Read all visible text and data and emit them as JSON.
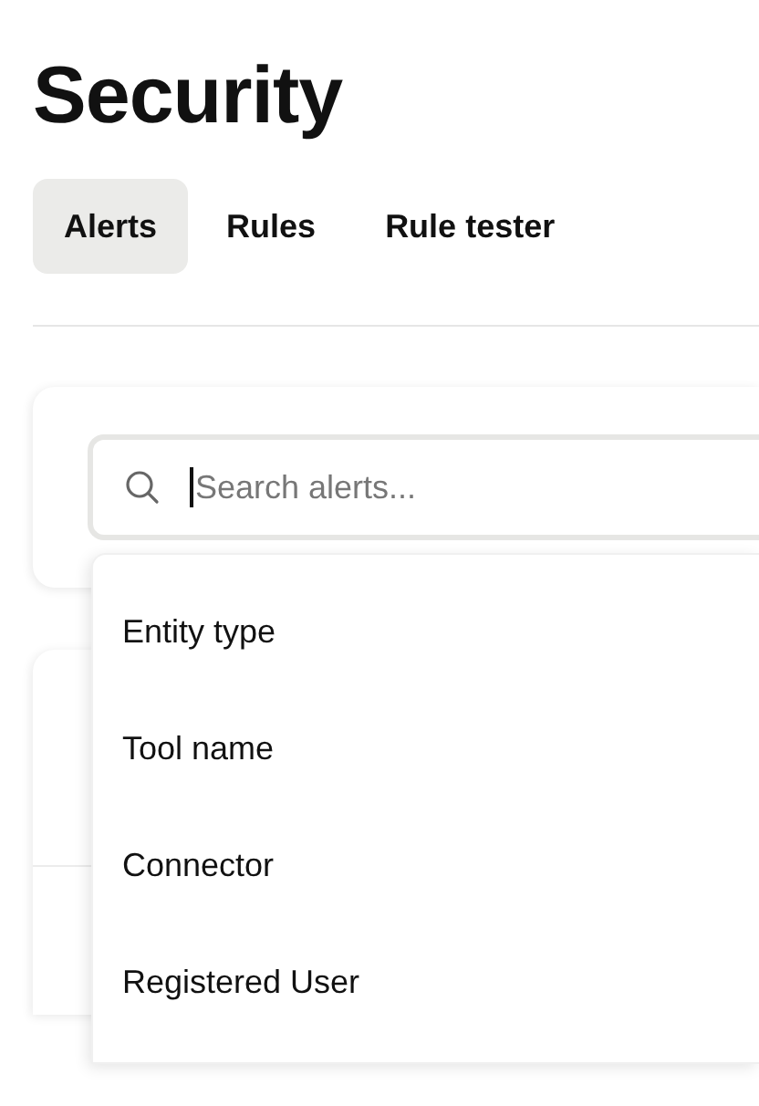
{
  "page": {
    "title": "Security"
  },
  "tabs": [
    {
      "label": "Alerts",
      "selected": true
    },
    {
      "label": "Rules",
      "selected": false
    },
    {
      "label": "Rule tester",
      "selected": false
    }
  ],
  "search": {
    "placeholder": "Search alerts...",
    "focused": true
  },
  "filter_menu": {
    "items": [
      {
        "label": "Entity type"
      },
      {
        "label": "Tool name"
      },
      {
        "label": "Connector"
      },
      {
        "label": "Registered User"
      }
    ]
  }
}
